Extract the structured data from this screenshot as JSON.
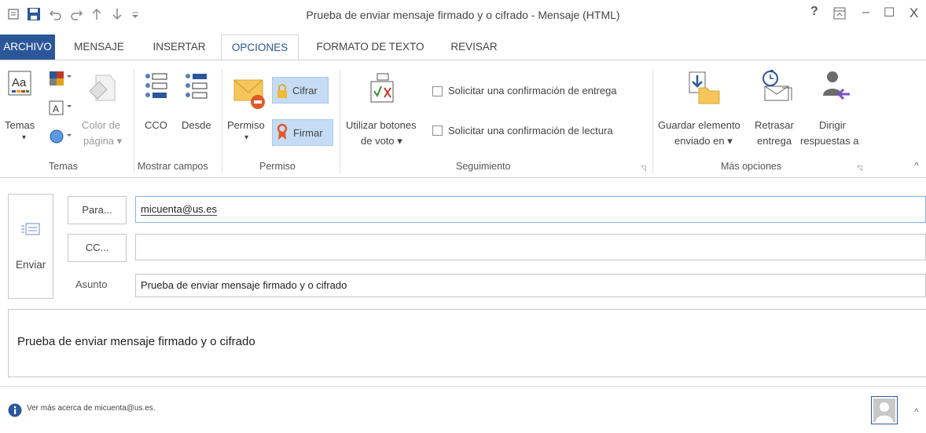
{
  "window": {
    "title": "Prueba de enviar mensaje firmado y o cifrado - Mensaje (HTML)",
    "help": "?",
    "minimize": "–",
    "maximize": "☐",
    "close": "X"
  },
  "tabs": [
    {
      "label": "ARCHIVO"
    },
    {
      "label": "MENSAJE"
    },
    {
      "label": "INSERTAR"
    },
    {
      "label": "OPCIONES"
    },
    {
      "label": "FORMATO DE TEXTO"
    },
    {
      "label": "REVISAR"
    }
  ],
  "ribbon": {
    "temas": {
      "button": "Temas",
      "dropdown": "▾",
      "color_line1": "Color de",
      "color_line2": "página ▾",
      "label": "Temas"
    },
    "mostrar": {
      "cco": "CCO",
      "desde": "Desde",
      "label": "Mostrar campos"
    },
    "permiso": {
      "permiso": "Permiso",
      "dropdown": "▾",
      "cifrar": "Cifrar",
      "firmar": "Firmar",
      "label": "Permiso"
    },
    "seguimiento": {
      "voto_line1": "Utilizar botones",
      "voto_line2": "de voto ▾",
      "entrega": "Solicitar una confirmación de entrega",
      "lectura": "Solicitar una confirmación de lectura",
      "label": "Seguimiento"
    },
    "mas": {
      "guardar_line1": "Guardar elemento",
      "guardar_line2": "enviado en ▾",
      "retrasar_line1": "Retrasar",
      "retrasar_line2": "entrega",
      "dirigir_line1": "Dirigir",
      "dirigir_line2": "respuestas a",
      "label": "Más opciones"
    },
    "launcher": "◹",
    "collapse": "^"
  },
  "compose": {
    "send": "Enviar",
    "para": "Para...",
    "cc": "CC...",
    "asunto": "Asunto",
    "to_value": "micuenta@us.es",
    "cc_value": "",
    "subject_value": "Prueba de enviar mensaje firmado y o cifrado",
    "body": "Prueba de enviar mensaje firmado y o cifrado"
  },
  "people_pane": {
    "info": "Ver más acerca de micuenta@us.es.",
    "expand": "^"
  },
  "colors": {
    "accent": "#2b579a",
    "highlight": "#c5dcf4"
  }
}
